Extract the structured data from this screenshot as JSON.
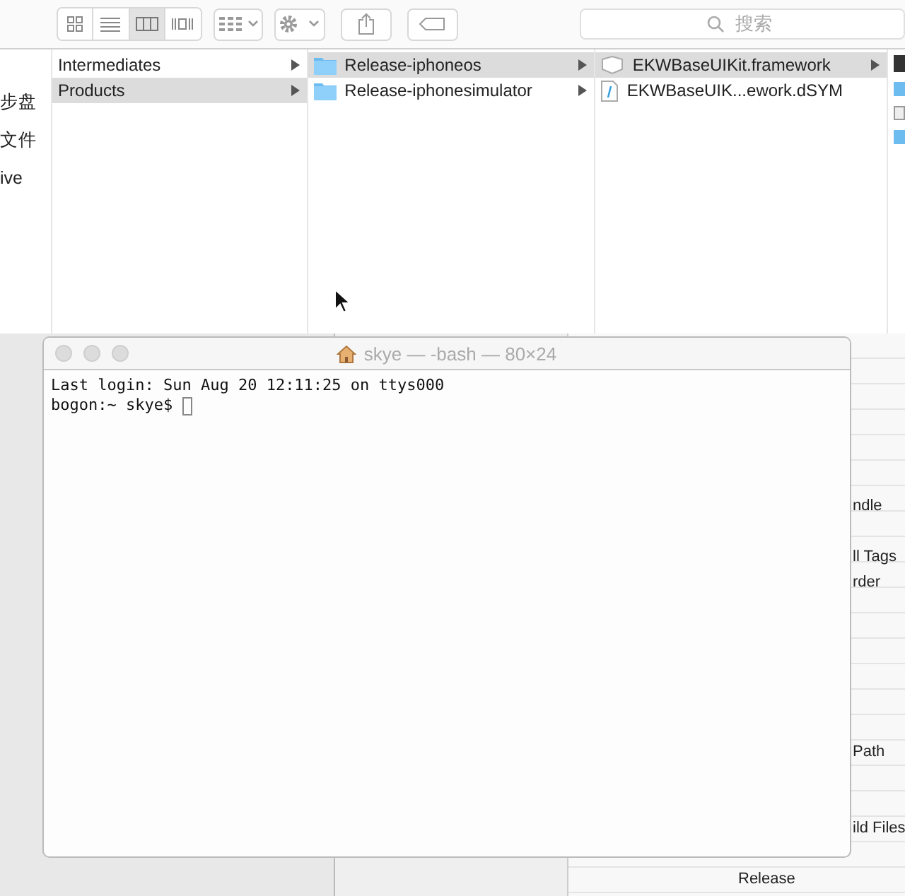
{
  "toolbar": {
    "view_buttons": [
      {
        "kind": "icons",
        "selected": false
      },
      {
        "kind": "list",
        "selected": false
      },
      {
        "kind": "columns",
        "selected": true
      },
      {
        "kind": "coverflow",
        "selected": false
      }
    ],
    "search": {
      "placeholder": "搜索"
    }
  },
  "sidebar": {
    "items": [
      "步盘",
      "文件",
      "ive"
    ]
  },
  "columns": [
    {
      "items": [
        {
          "label": "Intermediates",
          "kind": "none",
          "selected": false,
          "has_children": true
        },
        {
          "label": "Products",
          "kind": "none",
          "selected": true,
          "has_children": true
        }
      ]
    },
    {
      "items": [
        {
          "label": "Release-iphoneos",
          "kind": "folder",
          "selected": true,
          "has_children": true
        },
        {
          "label": "Release-iphonesimulator",
          "kind": "folder",
          "selected": false,
          "has_children": true
        }
      ]
    },
    {
      "items": [
        {
          "label": "EKWBaseUIKit.framework",
          "kind": "framework",
          "selected": true,
          "has_children": true
        },
        {
          "label": "EKWBaseUIK...ework.dSYM",
          "kind": "dsym",
          "selected": false,
          "has_children": false
        }
      ]
    }
  ],
  "settings_rows": [
    "ndle",
    "ll Tags",
    "rder",
    "Path",
    "ild Files",
    "Release"
  ],
  "terminal": {
    "title": "skye — -bash — 80×24",
    "lines": [
      "Last login: Sun Aug 20 12:11:25 on ttys000",
      "bogon:~ skye$"
    ]
  }
}
